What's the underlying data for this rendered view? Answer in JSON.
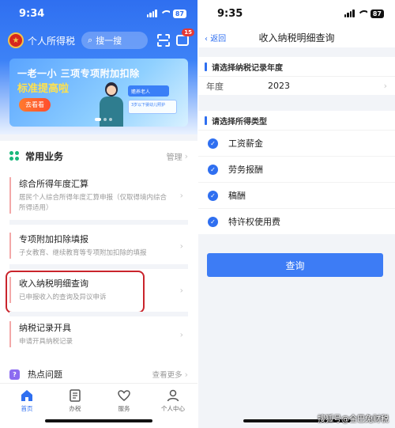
{
  "left": {
    "status": {
      "time": "9:34",
      "battery": "87"
    },
    "appbar": {
      "name": "个人所得税",
      "search_placeholder": "搜一搜",
      "msg_badge": "15"
    },
    "banner": {
      "line1": "一老一小 三项专项附加扣除",
      "line2": "标准提高啦",
      "button": "去看看",
      "card1": "赡养老人",
      "card2": "3岁以下婴幼儿照护"
    },
    "section": {
      "title": "常用业务",
      "manage": "管理"
    },
    "cards": [
      {
        "title": "综合所得年度汇算",
        "sub": "居民个人综合所得年度汇算申报（仅取得境内综合所得适用）"
      },
      {
        "title": "专项附加扣除填报",
        "sub": "子女教育、继续教育等专项附加扣除的填报"
      },
      {
        "title": "收入纳税明细查询",
        "sub": "已申报收入的查询及异议申诉"
      },
      {
        "title": "纳税记录开具",
        "sub": "申请开具纳税记录"
      }
    ],
    "hot": {
      "icon": "?",
      "title": "热点问题",
      "more": "查看更多"
    },
    "tabs": [
      {
        "label": "首页",
        "icon": "home-icon"
      },
      {
        "label": "办税",
        "icon": "document-icon"
      },
      {
        "label": "服务",
        "icon": "handshake-icon"
      },
      {
        "label": "个人中心",
        "icon": "person-icon"
      }
    ],
    "colors": {
      "primary": "#2f6ff0",
      "highlight": "#c9242c"
    }
  },
  "right": {
    "status": {
      "time": "9:35",
      "battery": "87"
    },
    "nav": {
      "back": "返回",
      "title": "收入纳税明细查询"
    },
    "year_section": {
      "title": "请选择纳税记录年度",
      "label": "年度",
      "value": "2023"
    },
    "type_section": {
      "title": "请选择所得类型",
      "options": [
        "工资薪金",
        "劳务报酬",
        "稿酬",
        "特许权使用费"
      ]
    },
    "query_button": "查询",
    "watermark": "搜狐号@全巴兔财税"
  }
}
